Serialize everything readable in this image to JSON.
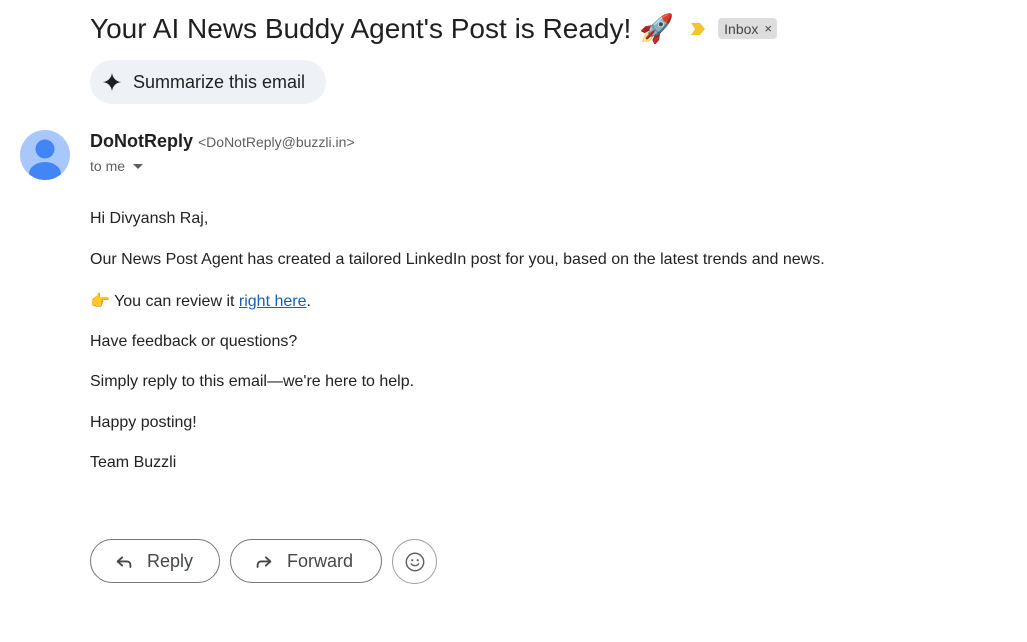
{
  "email": {
    "subject": "Your AI News Buddy Agent's Post is Ready!",
    "subject_emoji": "🚀",
    "label": "Inbox",
    "label_close": "×"
  },
  "summarize": {
    "label": "Summarize this email",
    "icon": "sparkle-icon"
  },
  "sender": {
    "name": "DoNotReply",
    "email": "<DoNotReply@buzzli.in>",
    "recipient": "to me"
  },
  "body": {
    "greeting": "Hi Divyansh Raj,",
    "line1": "Our News Post Agent has created a tailored LinkedIn post for you, based on the latest trends and news.",
    "line2_emoji": "👉",
    "line2_prefix": " You can review it ",
    "line2_link": "right here",
    "line2_suffix": ".",
    "line3": "Have feedback or questions?",
    "line4": "Simply reply to this email—we're here to help.",
    "line5": "Happy posting!",
    "signoff": "Team Buzzli"
  },
  "actions": {
    "reply_label": "Reply",
    "forward_label": "Forward",
    "emoji_icon": "smiley-icon"
  },
  "colors": {
    "importance_marker": "#f4c430",
    "avatar_bg": "#a8c7fa",
    "avatar_fg": "#4285f4",
    "link": "#1a5fb4"
  }
}
